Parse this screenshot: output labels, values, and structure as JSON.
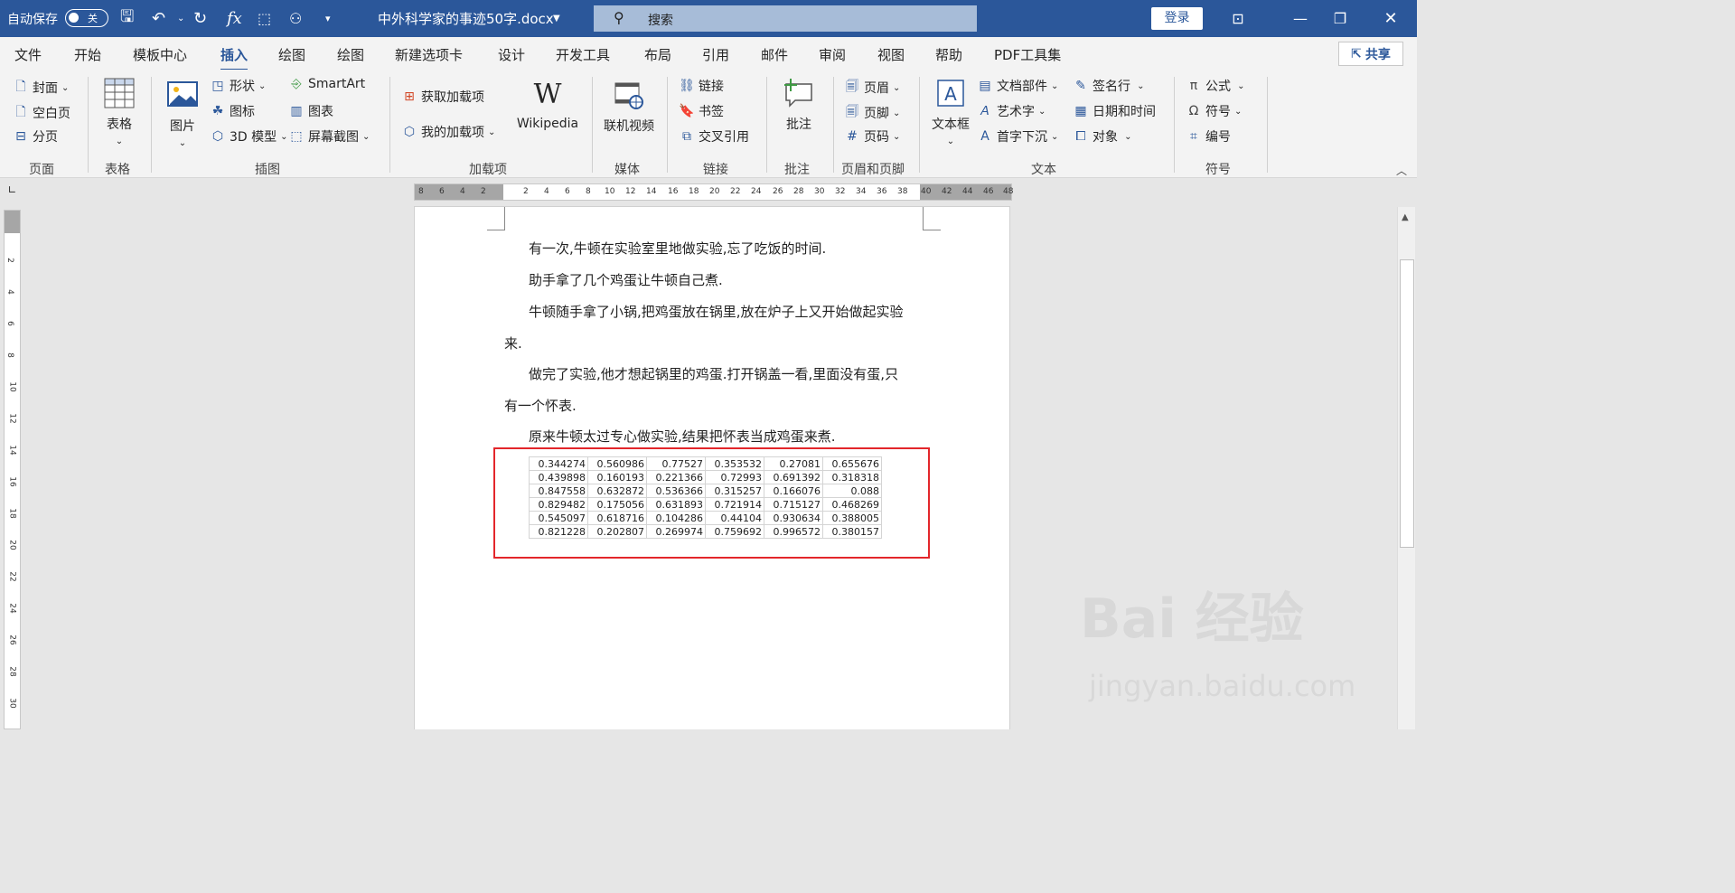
{
  "titlebar": {
    "autosave_label": "自动保存",
    "autosave_state": "关",
    "doc_title": "中外科学家的事迹50字.docx",
    "search_placeholder": "搜索",
    "login_label": "登录"
  },
  "menu": {
    "tabs": [
      "文件",
      "开始",
      "模板中心",
      "插入",
      "绘图",
      "绘图",
      "新建选项卡",
      "设计",
      "开发工具",
      "布局",
      "引用",
      "邮件",
      "审阅",
      "视图",
      "帮助",
      "PDF工具集"
    ],
    "active_tab": "插入",
    "share_label": "共享"
  },
  "ribbon": {
    "pages": {
      "cover": "封面",
      "blank": "空白页",
      "break": "分页",
      "group": "页面"
    },
    "tables": {
      "table": "表格",
      "group": "表格"
    },
    "illustrations": {
      "picture": "图片",
      "shapes": "形状",
      "icons": "图标",
      "model3d": "3D 模型",
      "smartart": "SmartArt",
      "chart": "图表",
      "screenshot": "屏幕截图",
      "group": "插图"
    },
    "addins": {
      "get": "获取加载项",
      "mine": "我的加载项",
      "wikipedia": "Wikipedia",
      "group": "加载项"
    },
    "media": {
      "video": "联机视频",
      "group": "媒体"
    },
    "links": {
      "link": "链接",
      "bookmark": "书签",
      "crossref": "交叉引用",
      "group": "链接"
    },
    "comments": {
      "comment": "批注",
      "group": "批注"
    },
    "headerfooter": {
      "header": "页眉",
      "footer": "页脚",
      "pagenum": "页码",
      "group": "页眉和页脚"
    },
    "text": {
      "textbox": "文本框",
      "quickparts": "文档部件",
      "wordart": "艺术字",
      "dropcap": "首字下沉",
      "signature": "签名行",
      "datetime": "日期和时间",
      "object": "对象",
      "group": "文本"
    },
    "symbols": {
      "equation": "公式",
      "symbol": "符号",
      "number": "编号",
      "group": "符号"
    }
  },
  "ruler": {
    "h_left": [
      "8",
      "6",
      "4",
      "2"
    ],
    "h_right": [
      "2",
      "4",
      "6",
      "8",
      "10",
      "12",
      "14",
      "16",
      "18",
      "20",
      "22",
      "24",
      "26",
      "28",
      "30",
      "32",
      "34",
      "36",
      "38"
    ],
    "h_far": [
      "40",
      "42",
      "44",
      "46",
      "48"
    ],
    "v_ticks": [
      "2",
      "4",
      "6",
      "8",
      "10",
      "12",
      "14",
      "16",
      "18",
      "20",
      "22",
      "24",
      "26",
      "28",
      "30"
    ]
  },
  "document": {
    "paragraphs": [
      "有一次,牛顿在实验室里地做实验,忘了吃饭的时间.",
      "助手拿了几个鸡蛋让牛顿自己煮.",
      "牛顿随手拿了小锅,把鸡蛋放在锅里,放在炉子上又开始做起实验",
      "来.",
      "做完了实验,他才想起锅里的鸡蛋.打开锅盖一看,里面没有蛋,只",
      "有一个怀表.",
      "原来牛顿太过专心做实验,结果把怀表当成鸡蛋来煮."
    ],
    "table": [
      [
        "0.344274",
        "0.560986",
        "0.77527",
        "0.353532",
        "0.27081",
        "0.655676"
      ],
      [
        "0.439898",
        "0.160193",
        "0.221366",
        "0.72993",
        "0.691392",
        "0.318318"
      ],
      [
        "0.847558",
        "0.632872",
        "0.536366",
        "0.315257",
        "0.166076",
        "0.088"
      ],
      [
        "0.829482",
        "0.175056",
        "0.631893",
        "0.721914",
        "0.715127",
        "0.468269"
      ],
      [
        "0.545097",
        "0.618716",
        "0.104286",
        "0.44104",
        "0.930634",
        "0.388005"
      ],
      [
        "0.821228",
        "0.202807",
        "0.269974",
        "0.759692",
        "0.996572",
        "0.380157"
      ]
    ]
  },
  "watermark": {
    "brand": "Bai 经验",
    "url": "jingyan.baidu.com"
  },
  "colors": {
    "titlebar": "#2b579a",
    "highlight_box": "#e3262b"
  }
}
